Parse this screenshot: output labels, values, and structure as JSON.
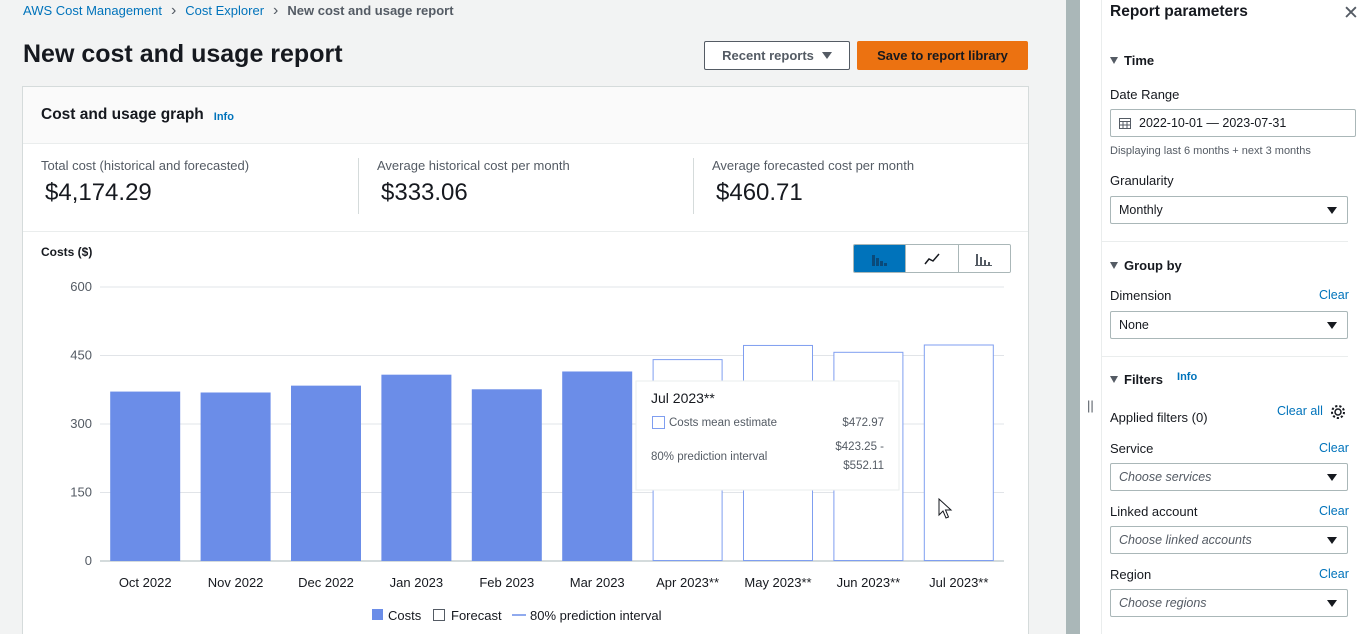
{
  "breadcrumb": {
    "items": [
      "AWS Cost Management",
      "Cost Explorer"
    ],
    "current": "New cost and usage report"
  },
  "header": {
    "title": "New cost and usage report",
    "recent_reports": "Recent reports",
    "save": "Save to report library"
  },
  "card": {
    "title": "Cost and usage graph",
    "info": "Info",
    "metrics": [
      {
        "label": "Total cost (historical and forecasted)",
        "value": "$4,174.29"
      },
      {
        "label": "Average historical cost per month",
        "value": "$333.06"
      },
      {
        "label": "Average forecasted cost per month",
        "value": "$460.71"
      }
    ],
    "costs_label": "Costs ($)"
  },
  "colors": {
    "bar": "#6b8de8",
    "forecast_stroke": "#7f9ef0",
    "link": "#0073bb",
    "primary": "#ec7211"
  },
  "chart_data": {
    "type": "bar",
    "ylim": [
      0,
      600
    ],
    "yticks": [
      0,
      150,
      300,
      450,
      600
    ],
    "categories": [
      "Oct 2022",
      "Nov 2022",
      "Dec 2022",
      "Jan 2023",
      "Feb 2023",
      "Mar 2023",
      "Apr 2023**",
      "May 2023**",
      "Jun 2023**",
      "Jul 2023**"
    ],
    "series": [
      {
        "name": "Costs",
        "values": [
          371,
          369,
          384,
          408,
          376,
          415,
          null,
          null,
          null,
          null
        ]
      },
      {
        "name": "Forecast",
        "values": [
          null,
          null,
          null,
          null,
          null,
          null,
          441,
          472,
          457,
          473
        ]
      }
    ],
    "legend": [
      "Costs",
      "Forecast",
      "80% prediction interval"
    ],
    "legend_position": "bottom",
    "grid": true
  },
  "tooltip": {
    "title": "Jul 2023**",
    "row1_label": "Costs mean estimate",
    "row1_value": "$472.97",
    "row2_label": "80% prediction interval",
    "row2_value_a": "$423.25 -",
    "row2_value_b": "$552.11"
  },
  "panel": {
    "title": "Report parameters",
    "time": {
      "section": "Time",
      "date_range_label": "Date Range",
      "date_range_value": "2022-10-01 — 2023-07-31",
      "hint": "Displaying last 6 months + next 3 months",
      "granularity_label": "Granularity",
      "granularity_value": "Monthly"
    },
    "group_by": {
      "section": "Group by",
      "dimension_label": "Dimension",
      "clear": "Clear",
      "dimension_value": "None"
    },
    "filters": {
      "section": "Filters",
      "info": "Info",
      "applied": "Applied filters (0)",
      "clear_all": "Clear all",
      "service_label": "Service",
      "service_placeholder": "Choose services",
      "linked_label": "Linked account",
      "linked_placeholder": "Choose linked accounts",
      "region_label": "Region",
      "region_placeholder": "Choose regions",
      "clear": "Clear"
    }
  }
}
